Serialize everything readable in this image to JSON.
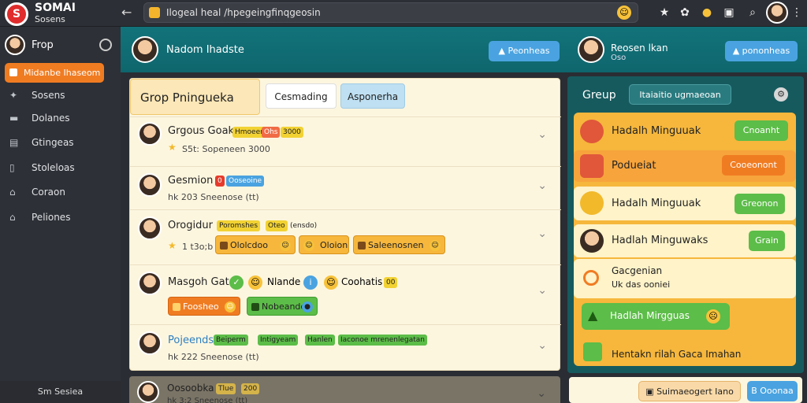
{
  "brand": {
    "name": "SOMAI",
    "sub": "Sosens"
  },
  "address": {
    "url": "Ilogeal heal /hpegeingfinqgeosin"
  },
  "sidebar": {
    "header": "Frop",
    "active": "Midanbe Ihaseom",
    "items": [
      {
        "label": "Sosens",
        "icon": "paw-icon"
      },
      {
        "label": "Dolanes",
        "icon": "car-icon"
      },
      {
        "label": "Gtingeas",
        "icon": "chart-icon"
      },
      {
        "label": "Stoleloas",
        "icon": "phone-icon"
      },
      {
        "label": "Coraon",
        "icon": "home-icon"
      },
      {
        "label": "Peliones",
        "icon": "home-icon"
      }
    ],
    "footer": "Sm Sesiea"
  },
  "mainhead": {
    "name": "Nadom Ihadste",
    "btn1": "Peonheas",
    "name2": "Reosen lkan",
    "sub2": "Oso",
    "btn2": "pononheas"
  },
  "panel": {
    "tab_title": "Grop Pningueka",
    "tab1": "Cesmading",
    "tab2": "Asponerha",
    "rows": [
      {
        "title": "Grgous Goak",
        "badge1": "Hmoeen",
        "badge2": "Ohs",
        "badge3": "3000",
        "meta": "S5t: Sopeneen 3000"
      },
      {
        "title": "Gesmion",
        "badge1": "0",
        "badge2": "Ooseoine",
        "meta": "hk 203 Sneenose (tt)"
      },
      {
        "title": "Orogidur",
        "badge1": "Poromshes",
        "badge2": "Oteo",
        "badge3": "(ensdo)",
        "meta": "1 t3o;b",
        "chips": [
          "Ololcdoo",
          "Oloion",
          "Saleenosnen"
        ]
      },
      {
        "title": "Masgoh Gate",
        "tag1": "Nlande",
        "tag2": "Coohatis",
        "tag3": "00",
        "chips": [
          "Foosheo",
          "Nobeandoo"
        ]
      },
      {
        "title": "Pojeends",
        "t2": "Beiperm",
        "t3": "Intigyeam",
        "t4": "Hanlen",
        "t5": "Iaconoe mrenenlegatan",
        "meta": "hk 222 Sneenose (tt)"
      },
      {
        "title": "Oosoobka",
        "badge1": "Tlue",
        "badge2": "200",
        "meta": "hk 3:2 Sneenose (tt)"
      }
    ]
  },
  "rpanel": {
    "title": "Greup",
    "pill": "Itaiaitio ugmaeoan",
    "cards": [
      {
        "title": "Hadalh Minguuak",
        "button": "Cnoanht"
      },
      {
        "title": "Podueiat",
        "button": "Cooeonont"
      },
      {
        "title": "Hadalh Minguuak",
        "button": "Greonon"
      },
      {
        "title": "Hadlah Minguwaks",
        "button": "Grain"
      },
      {
        "title": "Gacgenian",
        "sub": "Uk das ooniei"
      },
      {
        "title": "Hadlah Mirgguas"
      },
      {
        "title": "Hentakn rilah Gaca Imahan"
      }
    ],
    "footer_btn1": "Suimaeogert Iano",
    "footer_btn2": "B Ooonaa"
  },
  "colors": {
    "accent": "#f07c22",
    "teal": "#12737a",
    "blue": "#4aa3e0",
    "green": "#5cbd48"
  }
}
